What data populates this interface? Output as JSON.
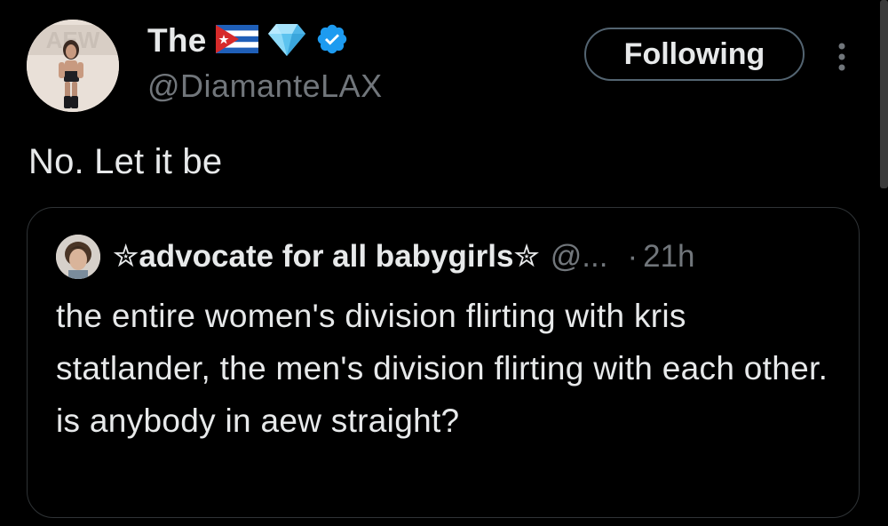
{
  "author": {
    "display_name": "The",
    "flag_icon": "cuba-flag-emoji",
    "gem_icon": "gem-stone-emoji",
    "verified_icon": "verified-badge-icon",
    "verified_color": "#1d9bf0",
    "handle": "@DiamanteLAX",
    "avatar_text": "AEW"
  },
  "actions": {
    "follow_label": "Following",
    "more_icon": "more-vertical-icon"
  },
  "tweet": {
    "text": "No. Let it be"
  },
  "quoted_tweet": {
    "display_name": "✮advocate for all babygirls✮",
    "handle": "@...",
    "separator": "·",
    "time": "21h",
    "text": "the entire women's division flirting with kris statlander, the men's division flirting with each other. is anybody in aew straight?"
  },
  "colors": {
    "background": "#000000",
    "primary_text": "#e7e9ea",
    "secondary_text": "#71767b",
    "border": "#2f3336"
  }
}
